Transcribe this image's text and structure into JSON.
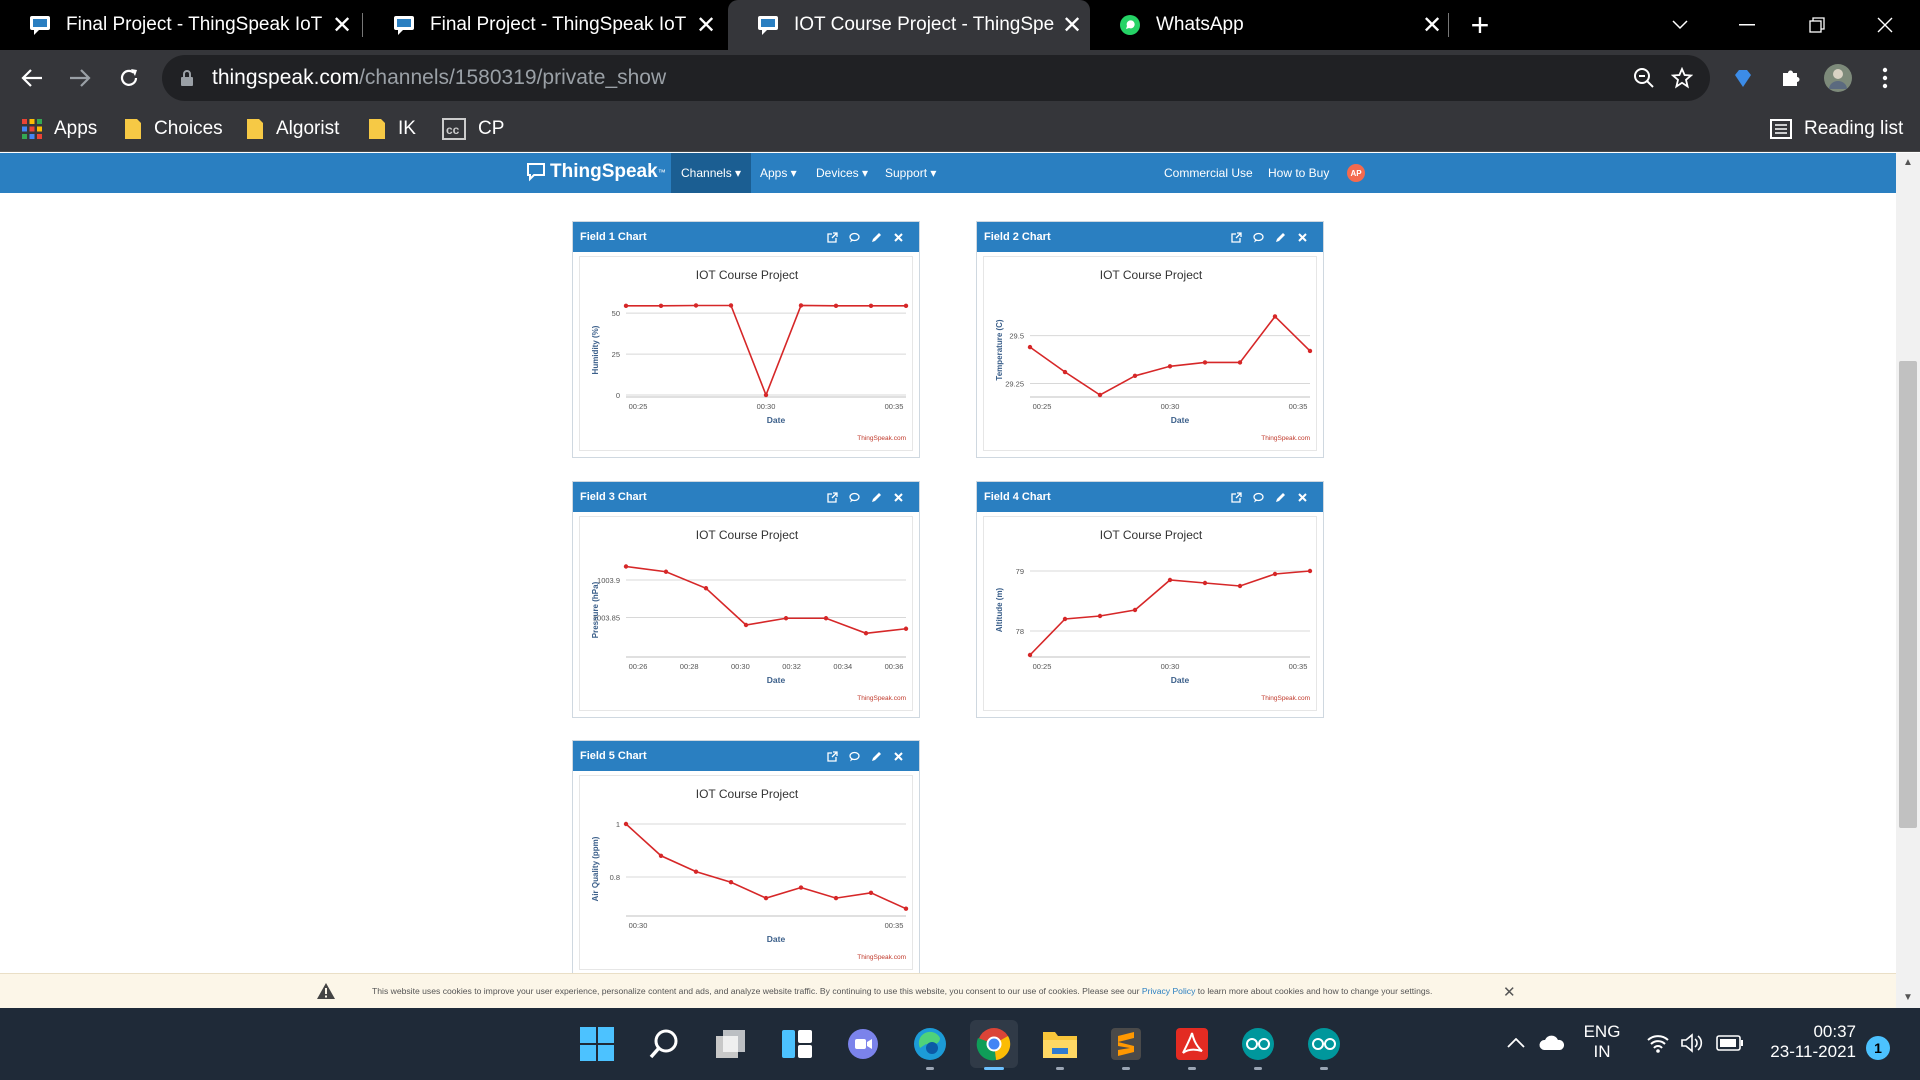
{
  "tabs": [
    {
      "title": "Final Project - ThingSpeak IoT",
      "icon": "thingspeak-favicon-icon"
    },
    {
      "title": "Final Project - ThingSpeak IoT",
      "icon": "thingspeak-favicon-icon"
    },
    {
      "title": "IOT Course Project - ThingSpeak",
      "icon": "thingspeak-favicon-icon",
      "active": true
    },
    {
      "title": "WhatsApp",
      "icon": "whatsapp-icon"
    }
  ],
  "address": {
    "host": "thingspeak.com",
    "path": "/channels/1580319/private_show"
  },
  "bookmarks": [
    {
      "label": "Apps",
      "icon": "apps-grid-icon"
    },
    {
      "label": "Choices",
      "icon": "folder-icon"
    },
    {
      "label": "Algorist",
      "icon": "folder-icon"
    },
    {
      "label": "IK",
      "icon": "folder-icon"
    },
    {
      "label": "CP",
      "icon": "cc-icon"
    }
  ],
  "reading_list": "Reading list",
  "site": {
    "logo_text": "ThingSpeak",
    "logo_tm": "™",
    "menu": [
      {
        "label": "Channels ▾",
        "active": true
      },
      {
        "label": "Apps ▾"
      },
      {
        "label": "Devices ▾"
      },
      {
        "label": "Support ▾"
      }
    ],
    "right_links": [
      "Commercial Use",
      "How to Buy"
    ],
    "avatar": "AP"
  },
  "colors": {
    "brand": "#2a7fc1",
    "line": "#d62728"
  },
  "chart_data": [
    {
      "type": "line",
      "panel_title": "Field 1 Chart",
      "title": "IOT Course Project",
      "xlabel": "Date",
      "ylabel": "Humidity (%)",
      "credit": "ThingSpeak.com",
      "x_ticks": [
        "00:25",
        "00:30",
        "00:35"
      ],
      "y_ticks": [
        0,
        25,
        50
      ],
      "ylim": [
        0,
        55
      ],
      "x": [
        0,
        1,
        2,
        3,
        4,
        5,
        6,
        7,
        8
      ],
      "values": [
        54.5,
        54.5,
        54.7,
        54.7,
        0,
        54.7,
        54.5,
        54.5,
        54.5
      ]
    },
    {
      "type": "line",
      "panel_title": "Field 2 Chart",
      "title": "IOT Course Project",
      "xlabel": "Date",
      "ylabel": "Temperature (C)",
      "credit": "ThingSpeak.com",
      "x_ticks": [
        "00:25",
        "00:30",
        "00:35"
      ],
      "y_ticks": [
        29.25,
        29.5
      ],
      "ylim": [
        29.19,
        29.66
      ],
      "x": [
        0,
        1,
        2,
        3,
        4,
        5,
        6,
        7,
        8
      ],
      "values": [
        29.44,
        29.31,
        29.19,
        29.29,
        29.34,
        29.36,
        29.36,
        29.6,
        29.42
      ]
    },
    {
      "type": "line",
      "panel_title": "Field 3 Chart",
      "title": "IOT Course Project",
      "xlabel": "Date",
      "ylabel": "Pressure (hPa)",
      "credit": "ThingSpeak.com",
      "x_ticks": [
        "00:26",
        "00:28",
        "00:30",
        "00:32",
        "00:34",
        "00:36"
      ],
      "y_ticks": [
        1003.85,
        1003.9
      ],
      "ylim": [
        1003.8,
        1003.92
      ],
      "x": [
        0,
        1,
        2,
        3,
        4,
        5,
        6,
        7
      ],
      "values": [
        1003.918,
        1003.911,
        1003.889,
        1003.84,
        1003.849,
        1003.849,
        1003.829,
        1003.835
      ]
    },
    {
      "type": "line",
      "panel_title": "Field 4 Chart",
      "title": "IOT Course Project",
      "xlabel": "Date",
      "ylabel": "Altitude (m)",
      "credit": "ThingSpeak.com",
      "x_ticks": [
        "00:25",
        "00:30",
        "00:35"
      ],
      "y_ticks": [
        78,
        79
      ],
      "ylim": [
        77.6,
        79.1
      ],
      "x": [
        0,
        1,
        2,
        3,
        4,
        5,
        6,
        7,
        8
      ],
      "values": [
        77.6,
        78.2,
        78.25,
        78.35,
        78.85,
        78.8,
        78.75,
        78.95,
        79.0
      ]
    },
    {
      "type": "line",
      "panel_title": "Field 5 Chart",
      "title": "IOT Course Project",
      "xlabel": "Date",
      "ylabel": "Air Quality (ppm)",
      "credit": "ThingSpeak.com",
      "x_ticks": [
        "00:30",
        "00:35"
      ],
      "y_ticks": [
        0.8,
        1
      ],
      "ylim": [
        0.66,
        1.0
      ],
      "x": [
        0,
        1,
        2,
        3,
        4,
        5,
        6,
        7,
        8
      ],
      "values": [
        1.0,
        0.88,
        0.82,
        0.78,
        0.72,
        0.76,
        0.72,
        0.74,
        0.68
      ]
    }
  ],
  "cookie": {
    "message": "This website uses cookies to improve your user experience, personalize content and ads, and analyze website traffic. By continuing to use this website, you consent to our use of cookies. Please see our",
    "link": "Privacy Policy",
    "message_end": "to learn more about cookies and how to change your settings."
  },
  "taskbar": {
    "language": [
      "ENG",
      "IN"
    ],
    "time": "00:37",
    "date": "23-11-2021",
    "notifications": "1"
  }
}
